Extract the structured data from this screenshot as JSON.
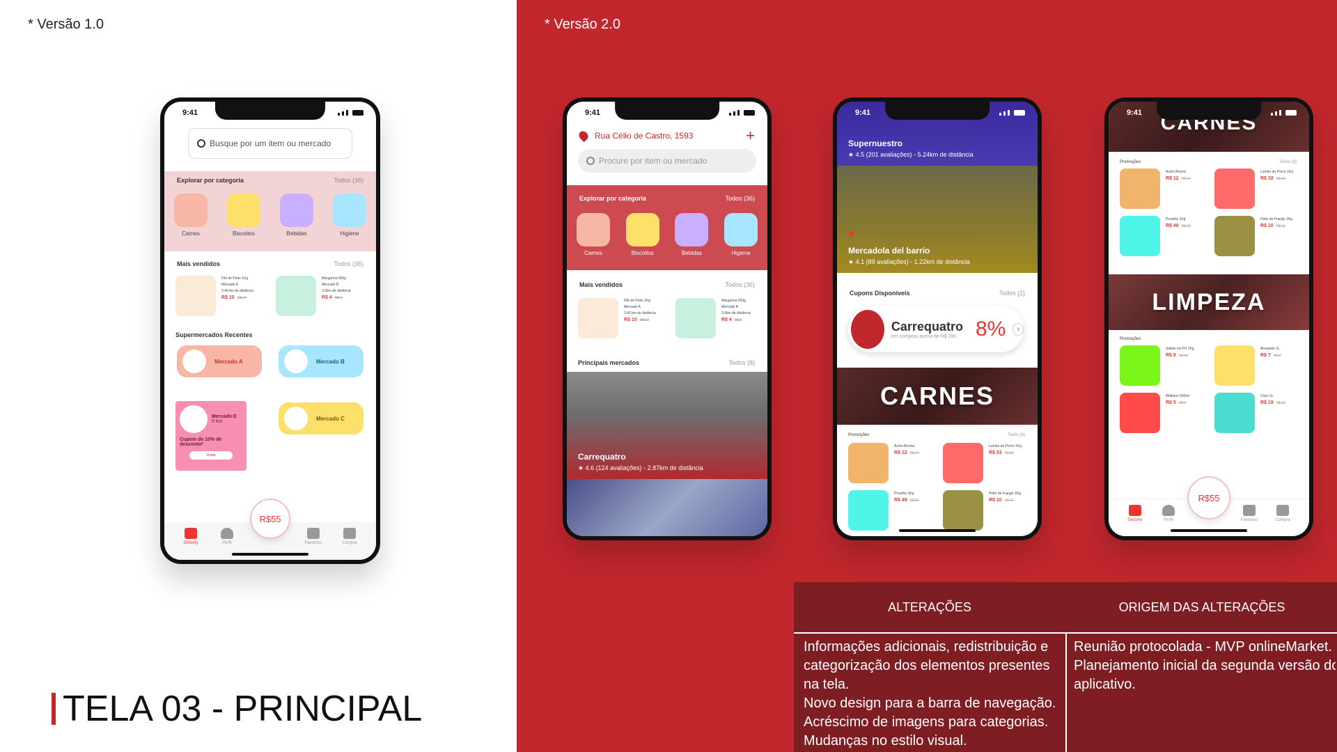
{
  "left": {
    "version_label": "* Versão 1.0",
    "title": "TELA 03 - PRINCIPAL"
  },
  "right": {
    "version_label": "* Versão 2.0"
  },
  "phone_v1": {
    "time": "9:41",
    "search_placeholder": "Busque por um item ou mercado",
    "explore_title": "Explorar por categoria",
    "explore_all": "Todos (36)",
    "categories": [
      "Carnes",
      "Biscoitos",
      "Bebidas",
      "Higiene"
    ],
    "bestsellers_title": "Mais vendidos",
    "bestsellers_all": "Todos (36)",
    "products": [
      {
        "name": "Filé de Peito 1Kg",
        "market": "Mercado A",
        "distance": "2.40 km de distância",
        "price": "R$ 10",
        "old": "R$ 14"
      },
      {
        "name": "Margarina 500g",
        "market": "Mercado B",
        "distance": "3.6km de distância",
        "price": "R$ 4",
        "old": "R$ 6"
      }
    ],
    "recent_title": "Supermercados Recentes",
    "markets": [
      "Mercado A",
      "Mercado B",
      "Mercado D",
      "Mercado C"
    ],
    "promo_text": "Cupom de 10% de desconto*",
    "promo_distance": "5 km",
    "promo_button": "Visitar",
    "cart_total": "R$55",
    "nav": [
      "Grocery",
      "Perfil",
      "Favoritos",
      "Compra"
    ]
  },
  "phone_v2a": {
    "time": "9:41",
    "address": "Rua Célio de Castro, 1593",
    "search_placeholder": "Procure por item ou mercado",
    "explore_title": "Explorar por categoria",
    "explore_all": "Todos (36)",
    "categories": [
      "Carnes",
      "Biscoitos",
      "Bebidas",
      "Higiene"
    ],
    "bestsellers_title": "Mais vendidos",
    "bestsellers_all": "Todos (36)",
    "products": [
      {
        "name": "Filé de Peito 1Kg",
        "market": "Mercado A",
        "distance": "2.40 km de distância",
        "price": "R$ 10",
        "old": "R$ 14"
      },
      {
        "name": "Margarina 500g",
        "market": "Mercado B",
        "distance": "3.6km de distância",
        "price": "R$ 4",
        "old": "R$ 6"
      }
    ],
    "markets_title": "Principais mercados",
    "markets_all": "Todos (8)",
    "featured_market": "Carrequatro",
    "featured_rating": "4.6",
    "featured_meta": "(124 avaliações) - 2.87km de distância"
  },
  "phone_v2b": {
    "time": "9:41",
    "market1_name": "Supernuestro",
    "market1_rating": "4.5",
    "market1_meta": "(201 avaliações) - 5.24km de distância",
    "market2_name": "Mercadola del barrio",
    "market2_rating": "4.1",
    "market2_meta": "(89 avaliações) - 1.22km de distância",
    "coupons_title": "Cupons Disponíveis",
    "coupons_all": "Todos (2)",
    "coupon_name": "Carrequatro",
    "coupon_sub": "em compras acima de R$ 200",
    "coupon_pct": "8%",
    "category_word": "CARNES",
    "promo_title": "Promoções",
    "promo_all": "Todos (8)",
    "products": [
      {
        "name": "Acém Bovino",
        "price": "R$ 12",
        "old": "R$ 14"
      },
      {
        "name": "Lombo de Porco 1Kg",
        "price": "R$ 53",
        "old": "R$ 59"
      },
      {
        "name": "Picanha 1Kg",
        "price": "R$ 49",
        "old": "R$ 52"
      },
      {
        "name": "Peito de Frango 1Kg",
        "price": "R$ 10",
        "old": "R$ 11"
      }
    ]
  },
  "phone_v2c": {
    "time": "9:41",
    "word1": "CARNES",
    "promo1_title": "Promoções",
    "promo1_all": "Todos (8)",
    "products1": [
      {
        "name": "Acém Bovino",
        "price": "R$ 12",
        "old": "R$ 14"
      },
      {
        "name": "Lombo de Porco 1Kg",
        "price": "R$ 32",
        "old": "R$ 35"
      },
      {
        "name": "Picanha 1Kg",
        "price": "R$ 49",
        "old": "R$ 52"
      },
      {
        "name": "Peito de Frango 1Kg",
        "price": "R$ 10",
        "old": "R$ 11"
      }
    ],
    "word2": "LIMPEZA",
    "promo2_title": "Promoções",
    "products2": [
      {
        "name": "Sabão em Pó 1Kg",
        "price": "R$ 8",
        "old": "R$ 10"
      },
      {
        "name": "Alvejante 1L",
        "price": "R$ 7",
        "old": "R$ 8"
      },
      {
        "name": "Multiuso 500ml",
        "price": "R$ 5",
        "old": "R$ 6"
      },
      {
        "name": "Cloro 1L",
        "price": "R$ 19",
        "old": "R$ 22"
      }
    ],
    "cart_total": "R$55",
    "nav": [
      "Grocery",
      "Perfil",
      "Favoritos",
      "Compra"
    ]
  },
  "table": {
    "col1_header": "ALTERAÇÕES",
    "col2_header": "ORIGEM DAS ALTERAÇÕES",
    "col1_lines": [
      "Informações adicionais, redistribuição e",
      "categorização dos elementos presentes",
      "na tela.",
      "Novo design para a barra de navegação.",
      "Acréscimo de imagens para categorias.",
      "Mudanças no estilo visual."
    ],
    "col2_lines": [
      "Reunião protocolada - MVP onlineMarket.",
      "Planejamento inicial da segunda versão do",
      "aplicativo."
    ]
  },
  "colors": {
    "brand_red": "#c1272d",
    "table_dark": "#7e1d22",
    "cat_carnes": "#f8b6a4",
    "cat_biscoitos": "#fde06a",
    "cat_bebidas": "#c9b0ff",
    "cat_higiene": "#a8e6ff"
  }
}
